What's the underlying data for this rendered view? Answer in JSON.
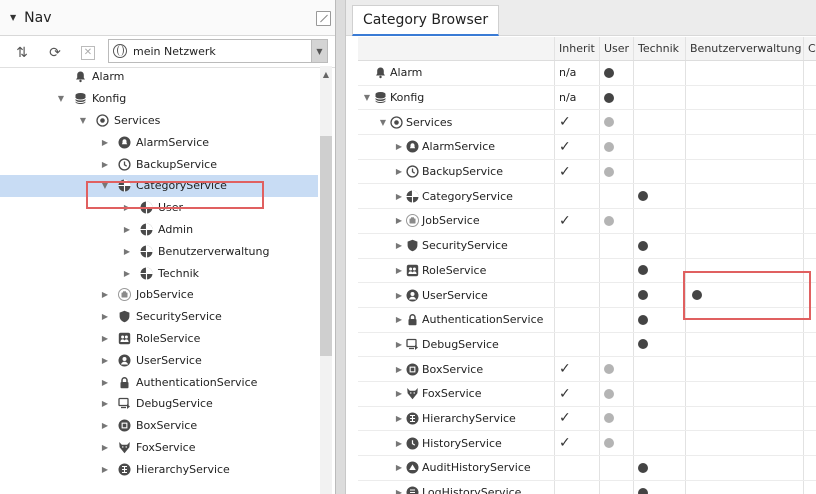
{
  "nav": {
    "title": "Nav",
    "network_select": "mein Netzwerk",
    "tree": [
      {
        "label": "Alarm",
        "indent": 1,
        "tri": "",
        "icon": "bell-icon",
        "selected": false
      },
      {
        "label": "Konfig",
        "indent": 1,
        "tri": "open",
        "icon": "database-icon",
        "selected": false
      },
      {
        "label": "Services",
        "indent": 2,
        "tri": "open",
        "icon": "services-icon",
        "selected": false
      },
      {
        "label": "AlarmService",
        "indent": 3,
        "tri": "closed",
        "icon": "alarm-service-icon",
        "selected": false
      },
      {
        "label": "BackupService",
        "indent": 3,
        "tri": "closed",
        "icon": "backup-icon",
        "selected": false
      },
      {
        "label": "CategoryService",
        "indent": 3,
        "tri": "open",
        "icon": "category-icon",
        "selected": true
      },
      {
        "label": "User",
        "indent": 4,
        "tri": "closed",
        "icon": "category-icon",
        "selected": false
      },
      {
        "label": "Admin",
        "indent": 4,
        "tri": "closed",
        "icon": "category-icon",
        "selected": false
      },
      {
        "label": "Benutzerverwaltung",
        "indent": 4,
        "tri": "closed",
        "icon": "category-icon",
        "selected": false
      },
      {
        "label": "Technik",
        "indent": 4,
        "tri": "closed",
        "icon": "category-icon",
        "selected": false
      },
      {
        "label": "JobService",
        "indent": 3,
        "tri": "closed",
        "icon": "job-icon",
        "selected": false
      },
      {
        "label": "SecurityService",
        "indent": 3,
        "tri": "closed",
        "icon": "shield-icon",
        "selected": false
      },
      {
        "label": "RoleService",
        "indent": 3,
        "tri": "closed",
        "icon": "role-icon",
        "selected": false
      },
      {
        "label": "UserService",
        "indent": 3,
        "tri": "closed",
        "icon": "user-icon",
        "selected": false
      },
      {
        "label": "AuthenticationService",
        "indent": 3,
        "tri": "closed",
        "icon": "lock-icon",
        "selected": false
      },
      {
        "label": "DebugService",
        "indent": 3,
        "tri": "closed",
        "icon": "debug-icon",
        "selected": false
      },
      {
        "label": "BoxService",
        "indent": 3,
        "tri": "closed",
        "icon": "box-icon",
        "selected": false
      },
      {
        "label": "FoxService",
        "indent": 3,
        "tri": "closed",
        "icon": "fox-icon",
        "selected": false
      },
      {
        "label": "HierarchyService",
        "indent": 3,
        "tri": "closed",
        "icon": "hierarchy-icon",
        "selected": false
      }
    ]
  },
  "category_browser": {
    "tab_label": "Category Browser",
    "columns": [
      "Inherit",
      "User",
      "Technik",
      "Benutzerverwaltung",
      "C"
    ],
    "rows": [
      {
        "label": "Alarm",
        "indent": 0,
        "tri": "",
        "icon": "bell-icon",
        "inherit": "n/a",
        "user": "dark",
        "technik": "",
        "benutzer": ""
      },
      {
        "label": "Konfig",
        "indent": 0,
        "tri": "open",
        "icon": "database-icon",
        "inherit": "n/a",
        "user": "dark",
        "technik": "",
        "benutzer": ""
      },
      {
        "label": "Services",
        "indent": 1,
        "tri": "open",
        "icon": "services-icon",
        "inherit": "check",
        "user": "light",
        "technik": "",
        "benutzer": ""
      },
      {
        "label": "AlarmService",
        "indent": 2,
        "tri": "closed",
        "icon": "alarm-service-icon",
        "inherit": "check",
        "user": "light",
        "technik": "",
        "benutzer": ""
      },
      {
        "label": "BackupService",
        "indent": 2,
        "tri": "closed",
        "icon": "backup-icon",
        "inherit": "check",
        "user": "light",
        "technik": "",
        "benutzer": ""
      },
      {
        "label": "CategoryService",
        "indent": 2,
        "tri": "closed",
        "icon": "category-icon",
        "inherit": "",
        "user": "",
        "technik": "dark",
        "benutzer": ""
      },
      {
        "label": "JobService",
        "indent": 2,
        "tri": "closed",
        "icon": "job-icon",
        "inherit": "check",
        "user": "light",
        "technik": "",
        "benutzer": ""
      },
      {
        "label": "SecurityService",
        "indent": 2,
        "tri": "closed",
        "icon": "shield-icon",
        "inherit": "",
        "user": "",
        "technik": "dark",
        "benutzer": ""
      },
      {
        "label": "RoleService",
        "indent": 2,
        "tri": "closed",
        "icon": "role-icon",
        "inherit": "",
        "user": "",
        "technik": "dark",
        "benutzer": ""
      },
      {
        "label": "UserService",
        "indent": 2,
        "tri": "closed",
        "icon": "user-icon",
        "inherit": "",
        "user": "",
        "technik": "dark",
        "benutzer": "dark"
      },
      {
        "label": "AuthenticationService",
        "indent": 2,
        "tri": "closed",
        "icon": "lock-icon",
        "inherit": "",
        "user": "",
        "technik": "dark",
        "benutzer": ""
      },
      {
        "label": "DebugService",
        "indent": 2,
        "tri": "closed",
        "icon": "debug-icon",
        "inherit": "",
        "user": "",
        "technik": "dark",
        "benutzer": ""
      },
      {
        "label": "BoxService",
        "indent": 2,
        "tri": "closed",
        "icon": "box-icon",
        "inherit": "check",
        "user": "light",
        "technik": "",
        "benutzer": ""
      },
      {
        "label": "FoxService",
        "indent": 2,
        "tri": "closed",
        "icon": "fox-icon",
        "inherit": "check",
        "user": "light",
        "technik": "",
        "benutzer": ""
      },
      {
        "label": "HierarchyService",
        "indent": 2,
        "tri": "closed",
        "icon": "hierarchy-icon",
        "inherit": "check",
        "user": "light",
        "technik": "",
        "benutzer": ""
      },
      {
        "label": "HistoryService",
        "indent": 2,
        "tri": "closed",
        "icon": "history-icon",
        "inherit": "check",
        "user": "light",
        "technik": "",
        "benutzer": ""
      },
      {
        "label": "AuditHistoryService",
        "indent": 2,
        "tri": "closed",
        "icon": "audit-icon",
        "inherit": "",
        "user": "",
        "technik": "dark",
        "benutzer": ""
      },
      {
        "label": "LogHistoryService",
        "indent": 2,
        "tri": "closed",
        "icon": "log-icon",
        "inherit": "",
        "user": "",
        "technik": "dark",
        "benutzer": ""
      }
    ]
  },
  "colors": {
    "selected_row": "#c8dcf4",
    "highlight_box": "#e06060",
    "dot_dark": "#444444",
    "dot_light": "#b4b4b4"
  }
}
